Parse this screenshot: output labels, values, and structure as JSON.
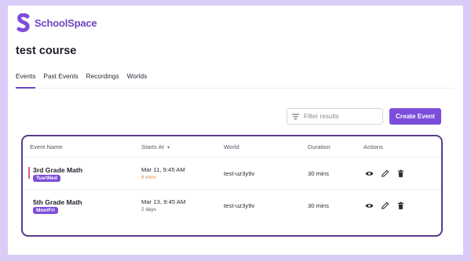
{
  "brand": {
    "name": "SchoolSpace"
  },
  "course": {
    "title": "test course"
  },
  "tabs": [
    {
      "label": "Events",
      "active": true
    },
    {
      "label": "Past Events",
      "active": false
    },
    {
      "label": "Recordings",
      "active": false
    },
    {
      "label": "Worlds",
      "active": false
    }
  ],
  "filter": {
    "placeholder": "Filter results",
    "value": ""
  },
  "create_button": {
    "label": "Create Event"
  },
  "table": {
    "headers": {
      "event_name": "Event Name",
      "starts_at": "Starts At",
      "world": "World",
      "duration": "Duration",
      "actions": "Actions"
    },
    "rows": [
      {
        "name": "3rd Grade Math",
        "days": "Tue/Wed",
        "starts": "Mar 11, 9:45 AM",
        "relative": "6 mins",
        "world": "test-uz3y9v",
        "duration": "30 mins"
      },
      {
        "name": "5th Grade Math",
        "days": "Mon/Fri",
        "starts": "Mar 13, 9:45 AM",
        "relative": "2 days",
        "world": "test-uz3y9v",
        "duration": "30 mins"
      }
    ]
  },
  "colors": {
    "brand": "#6b46c1",
    "accent": "#7c4ddb",
    "card_border": "#5a3c8c",
    "background": "#d9ccf7",
    "warning_text": "#e0894a",
    "live_marker": "#e05a8a"
  },
  "icons": {
    "logo": "schoolspace-s-logo",
    "filter": "filter-lines-icon",
    "sort": "chevron-down-icon",
    "view": "eye-icon",
    "edit": "pencil-icon",
    "delete": "trash-icon"
  }
}
